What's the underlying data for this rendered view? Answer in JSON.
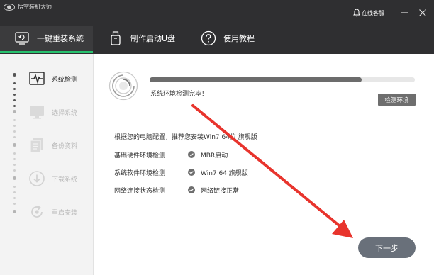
{
  "window": {
    "title": "悟空装机大师",
    "online_help": "在线客服",
    "icons": {
      "logo": "app-logo-icon",
      "bell": "bell-icon",
      "minimize": "minimize-icon",
      "close": "close-icon"
    }
  },
  "nav": {
    "tabs": [
      {
        "label": "一键重装系统",
        "icon": "monitor-reinstall-icon",
        "active": true
      },
      {
        "label": "制作启动U盘",
        "icon": "usb-drive-icon",
        "active": false
      },
      {
        "label": "使用教程",
        "icon": "question-circle-icon",
        "active": false
      }
    ]
  },
  "sidebar": {
    "steps": [
      {
        "label": "系统检测",
        "icon": "pulse-monitor-icon",
        "active": true
      },
      {
        "label": "选择系统",
        "icon": "monitor-icon",
        "active": false
      },
      {
        "label": "备份资料",
        "icon": "documents-icon",
        "active": false
      },
      {
        "label": "下载系统",
        "icon": "download-icon",
        "active": false
      },
      {
        "label": "重启安装",
        "icon": "restart-icon",
        "active": false
      }
    ]
  },
  "detection": {
    "progress": 0.8,
    "status": "系统环境检测完毕！",
    "env_button": "检测环境",
    "recommend": "根据您的电脑配置，推荐您安装Win7 64位 旗舰版",
    "checks": [
      {
        "label": "基础硬件环境检测",
        "result": "MBR启动"
      },
      {
        "label": "系统软件环境检测",
        "result": "Win7 64 旗舰版"
      },
      {
        "label": "网络连接状态检测",
        "result": "网络链接正常"
      }
    ]
  },
  "footer": {
    "next_button": "下一步"
  },
  "colors": {
    "accent": "#27c26e",
    "header": "#2f2f31",
    "arrow": "#e8342d",
    "button": "#69707a"
  }
}
